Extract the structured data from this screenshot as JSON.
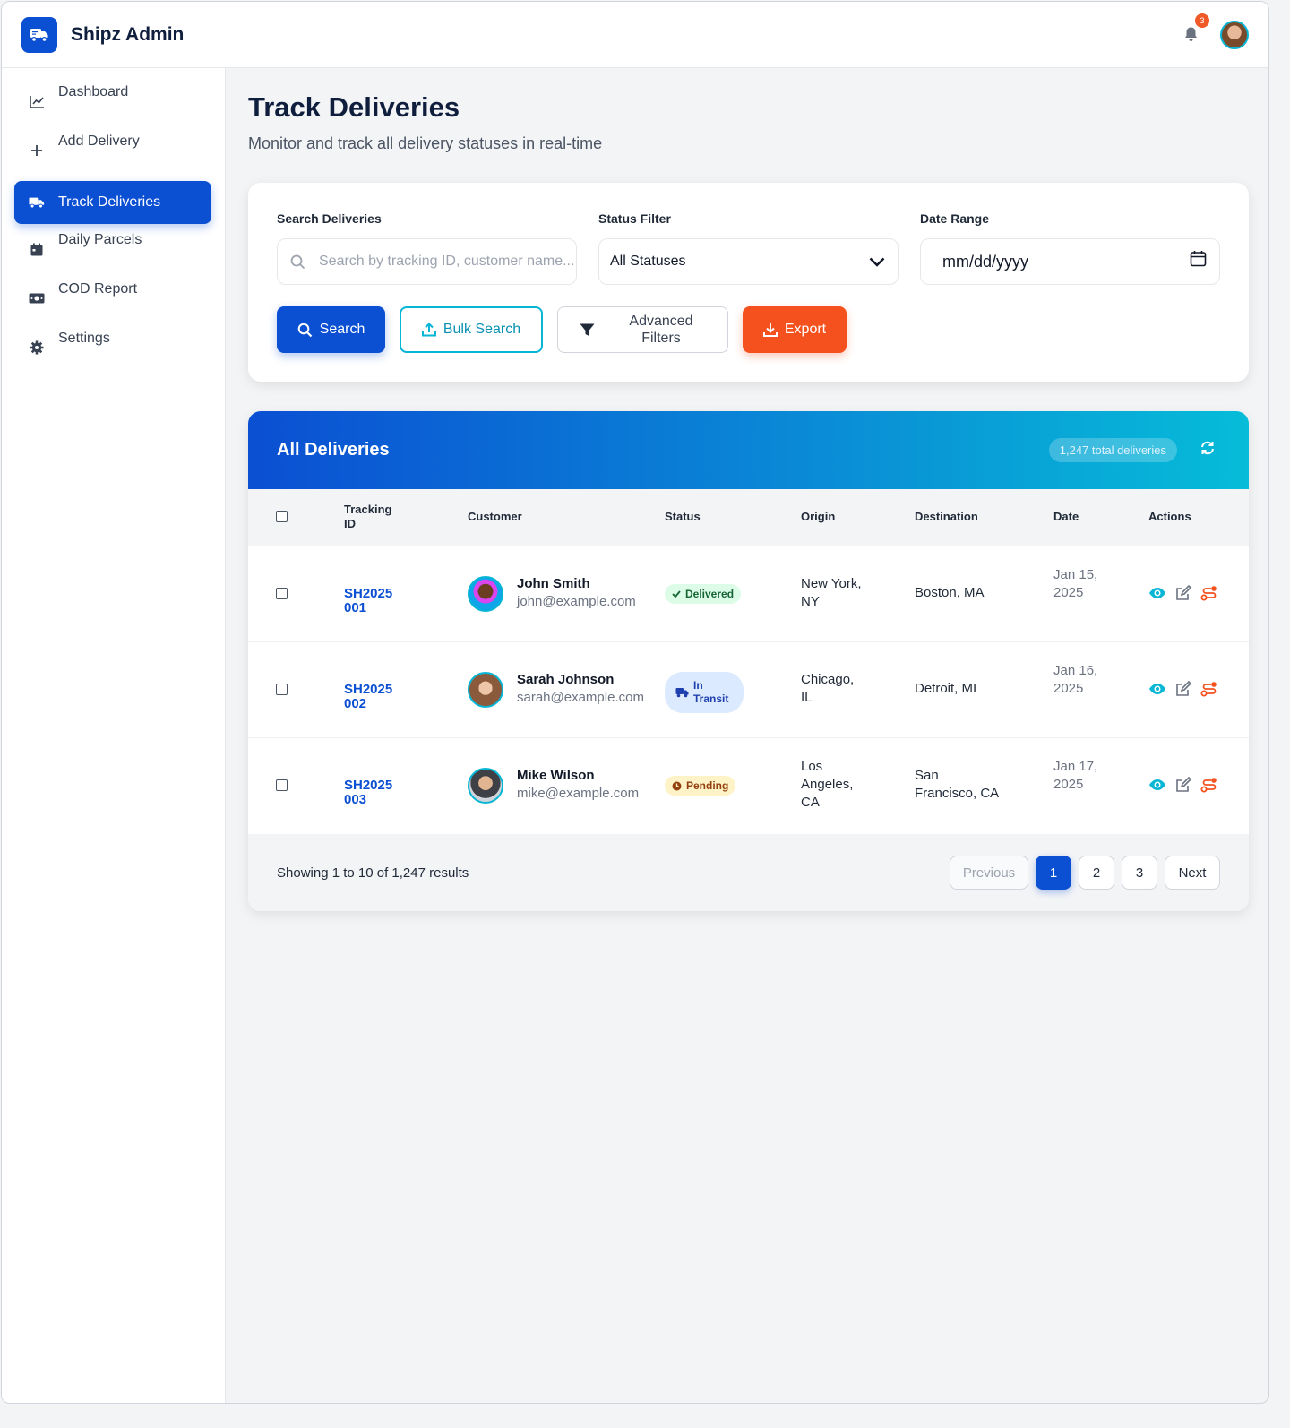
{
  "app": {
    "brand": "Shipz Admin",
    "notifications_count": "3"
  },
  "sidebar": {
    "items": [
      {
        "label": "Dashboard",
        "icon": "chart-line-icon"
      },
      {
        "label": "Add Delivery",
        "icon": "plus-icon"
      },
      {
        "label": "Track Deliveries",
        "icon": "truck-icon",
        "active": true
      },
      {
        "label": "Daily Parcels",
        "icon": "calendar-icon"
      },
      {
        "label": "COD Report",
        "icon": "money-bill-icon"
      },
      {
        "label": "Settings",
        "icon": "gear-icon"
      }
    ]
  },
  "page": {
    "title": "Track Deliveries",
    "subtitle": "Monitor and track all delivery statuses in real-time"
  },
  "filters": {
    "search_label": "Search Deliveries",
    "search_placeholder": "Search by tracking ID, customer name...",
    "status_label": "Status Filter",
    "status_value": "All Statuses",
    "date_label": "Date Range",
    "date_placeholder": "mm/dd/yyyy",
    "buttons": {
      "search": "Search",
      "bulk": "Bulk Search",
      "advanced": "Advanced Filters",
      "export": "Export"
    }
  },
  "table": {
    "title": "All Deliveries",
    "count": "1,247 total deliveries",
    "columns": {
      "tracking": "Tracking ID",
      "customer": "Customer",
      "status": "Status",
      "origin": "Origin",
      "destination": "Destination",
      "date": "Date",
      "actions": "Actions"
    },
    "rows": [
      {
        "tracking": "SH2025 001",
        "name": "John Smith",
        "email": "john@example.com",
        "status": "Delivered",
        "origin": "New York, NY",
        "destination": "Boston, MA",
        "date": "Jan 15, 2025"
      },
      {
        "tracking": "SH2025 002",
        "name": "Sarah Johnson",
        "email": "sarah@example.com",
        "status": "In Transit",
        "origin": "Chicago, IL",
        "destination": "Detroit, MI",
        "date": "Jan 16, 2025"
      },
      {
        "tracking": "SH2025 003",
        "name": "Mike Wilson",
        "email": "mike@example.com",
        "status": "Pending",
        "origin": "Los Angeles, CA",
        "destination": "San Francisco, CA",
        "date": "Jan 17, 2025"
      }
    ],
    "footer": {
      "showing": "Showing 1 to 10 of 1,247 results",
      "previous": "Previous",
      "pages": [
        "1",
        "2",
        "3"
      ],
      "next": "Next"
    }
  },
  "colors": {
    "primary": "#0b4fd3",
    "accent_cyan": "#06b6d4",
    "export_orange": "#f4511e",
    "delivered_green": "#166534",
    "transit_blue": "#1e40af",
    "pending_amber": "#92400e"
  }
}
